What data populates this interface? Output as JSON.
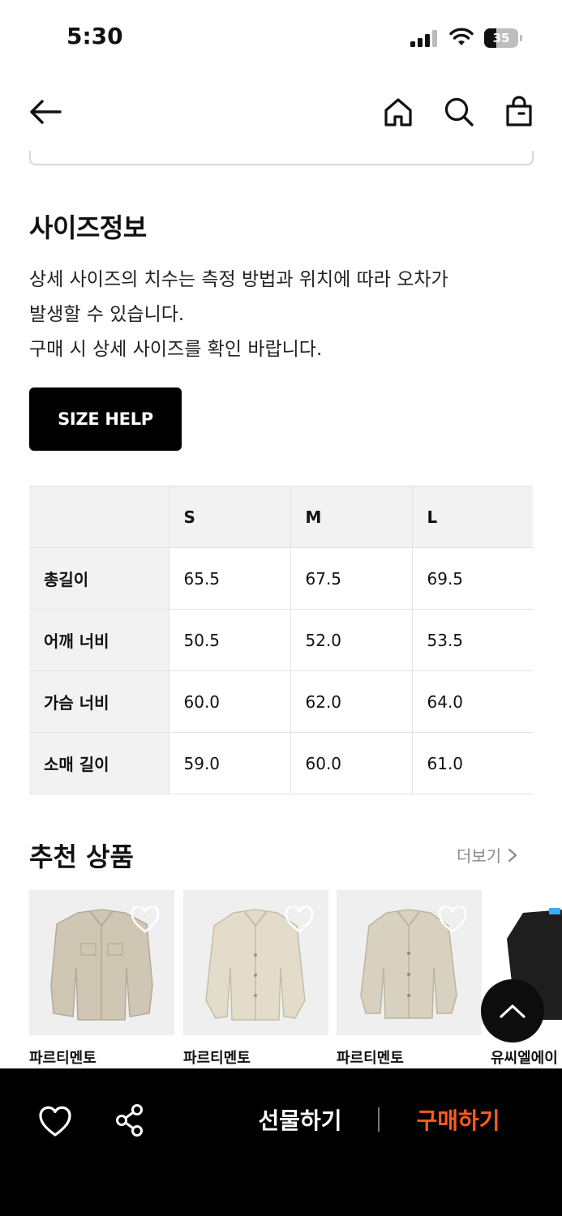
{
  "status_bar": {
    "time": "5:30",
    "battery_level": "35",
    "battery_fraction": 0.35
  },
  "header": {
    "back_icon": "arrow-left-icon",
    "home_icon": "home-icon",
    "search_icon": "search-icon",
    "bag_icon": "shopping-bag-icon"
  },
  "size_info": {
    "title": "사이즈정보",
    "description_lines": [
      "상세 사이즈의 치수는 측정 방법과 위치에 따라 오차가",
      "발생할 수 있습니다.",
      "구매 시 상세 사이즈를 확인 바랍니다."
    ],
    "size_help_label": "SIZE HELP",
    "table": {
      "headers": [
        "",
        "S",
        "M",
        "L"
      ],
      "rows": [
        {
          "label": "총길이",
          "values": [
            "65.5",
            "67.5",
            "69.5"
          ]
        },
        {
          "label": "어깨 너비",
          "values": [
            "50.5",
            "52.0",
            "53.5"
          ]
        },
        {
          "label": "가슴 너비",
          "values": [
            "60.0",
            "62.0",
            "64.0"
          ]
        },
        {
          "label": "소매 길이",
          "values": [
            "59.0",
            "60.0",
            "61.0"
          ]
        }
      ]
    }
  },
  "recommended": {
    "title": "추천 상품",
    "more_label": "더보기",
    "products": [
      {
        "brand": "파르티멘토",
        "color": "#cfc6b4"
      },
      {
        "brand": "파르티멘토",
        "color": "#e3dccb"
      },
      {
        "brand": "파르티멘토",
        "color": "#d8d1bf"
      },
      {
        "brand": "유씨엘에이",
        "color": "#1e1e1e"
      }
    ]
  },
  "bottom_bar": {
    "gift_label": "선물하기",
    "buy_label": "구매하기",
    "buy_color": "#ff5a1f"
  }
}
